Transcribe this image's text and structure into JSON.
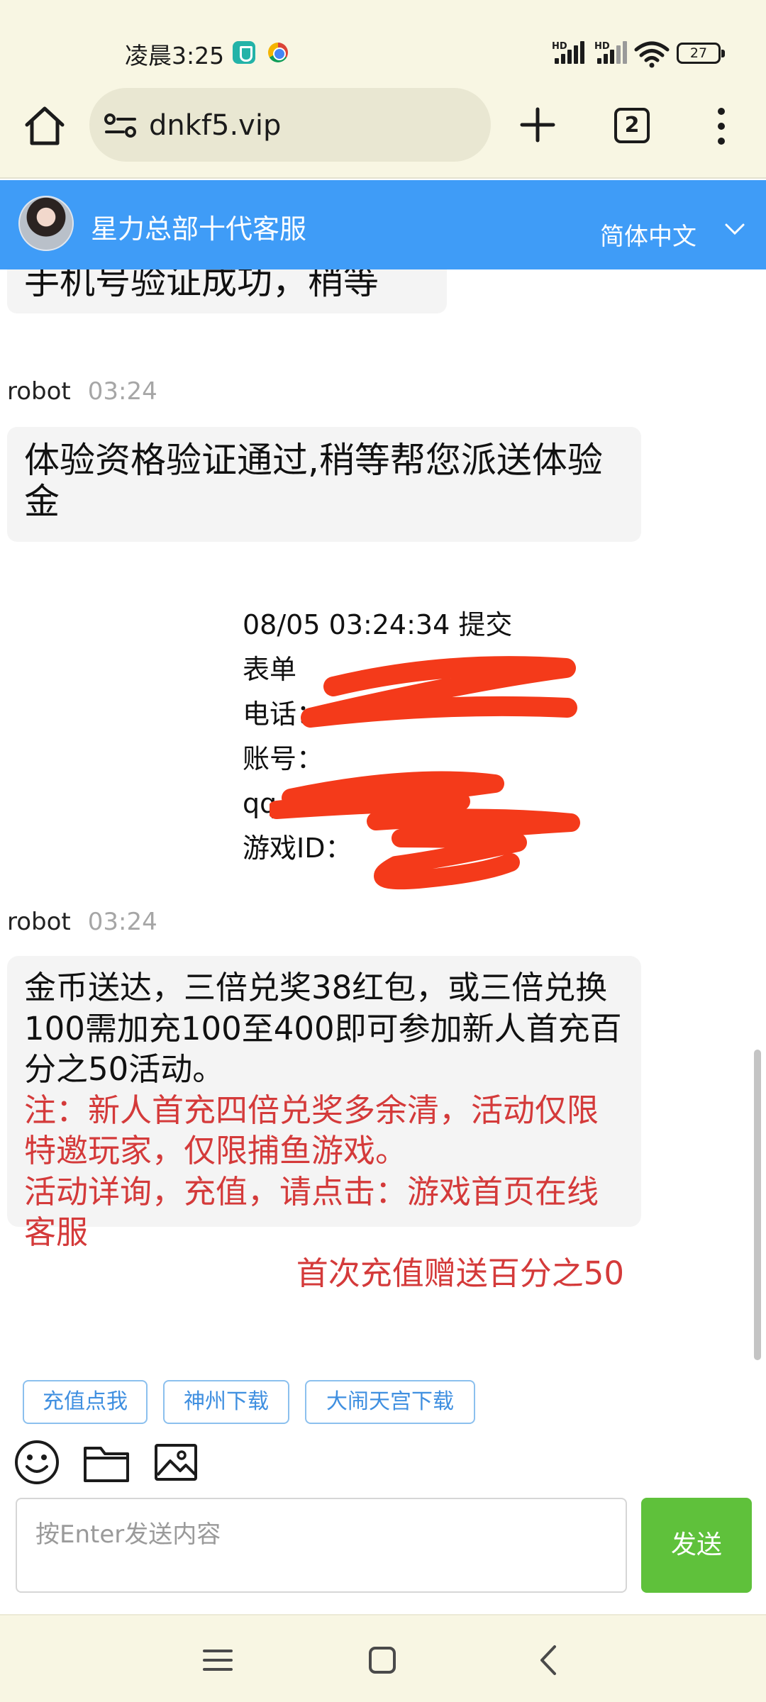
{
  "status_bar": {
    "time": "凌晨3:25",
    "signal_label_1": "HD",
    "signal_label_2": "HD",
    "battery": "27"
  },
  "browser": {
    "url": "dnkf5.vip",
    "tab_count": "2"
  },
  "chat_header": {
    "title": "星力总部十代客服",
    "language": "简体中文"
  },
  "messages": {
    "partial_top": "手机号验证成功，稍等",
    "robot_1": {
      "sender": "robot",
      "time": "03:24",
      "text": "体验资格验证通过,稍等帮您派送体验金"
    },
    "form": {
      "line_1": "08/05 03:24:34 提交",
      "line_2": "表单",
      "line_3": "电话：",
      "line_4": "账号：",
      "line_5": "qq",
      "line_6": "游戏ID："
    },
    "robot_2": {
      "sender": "robot",
      "time": "03:24",
      "text_black": "金币送达，三倍兑奖38红包，或三倍兑换100需加充100至400即可参加新人首充百分之50活动。",
      "text_red_1": "注：新人首充四倍兑奖多余清，活动仅限特邀玩家，仅限捕鱼游戏。",
      "text_red_2": "活动详询，充值，请点击：游戏首页在线客服",
      "text_red_3": "首次充值赠送百分之50"
    }
  },
  "quick_buttons": [
    "充值点我",
    "神州下载",
    "大闹天宫下载"
  ],
  "input": {
    "placeholder": "按Enter发送内容",
    "send_label": "发送"
  },
  "colors": {
    "header_blue": "#3f9cf7",
    "send_green": "#5fc13b",
    "notice_red": "#d43a3a",
    "redaction_red": "#f43a1a"
  },
  "icons": {
    "toolbar": [
      "home-icon",
      "site-settings-icon",
      "new-tab-icon",
      "tab-switcher-icon",
      "more-menu-icon"
    ],
    "chat_tools": [
      "emoji-icon",
      "folder-icon",
      "image-icon"
    ],
    "navigation": [
      "recent-apps-icon",
      "home-nav-icon",
      "back-icon"
    ]
  }
}
